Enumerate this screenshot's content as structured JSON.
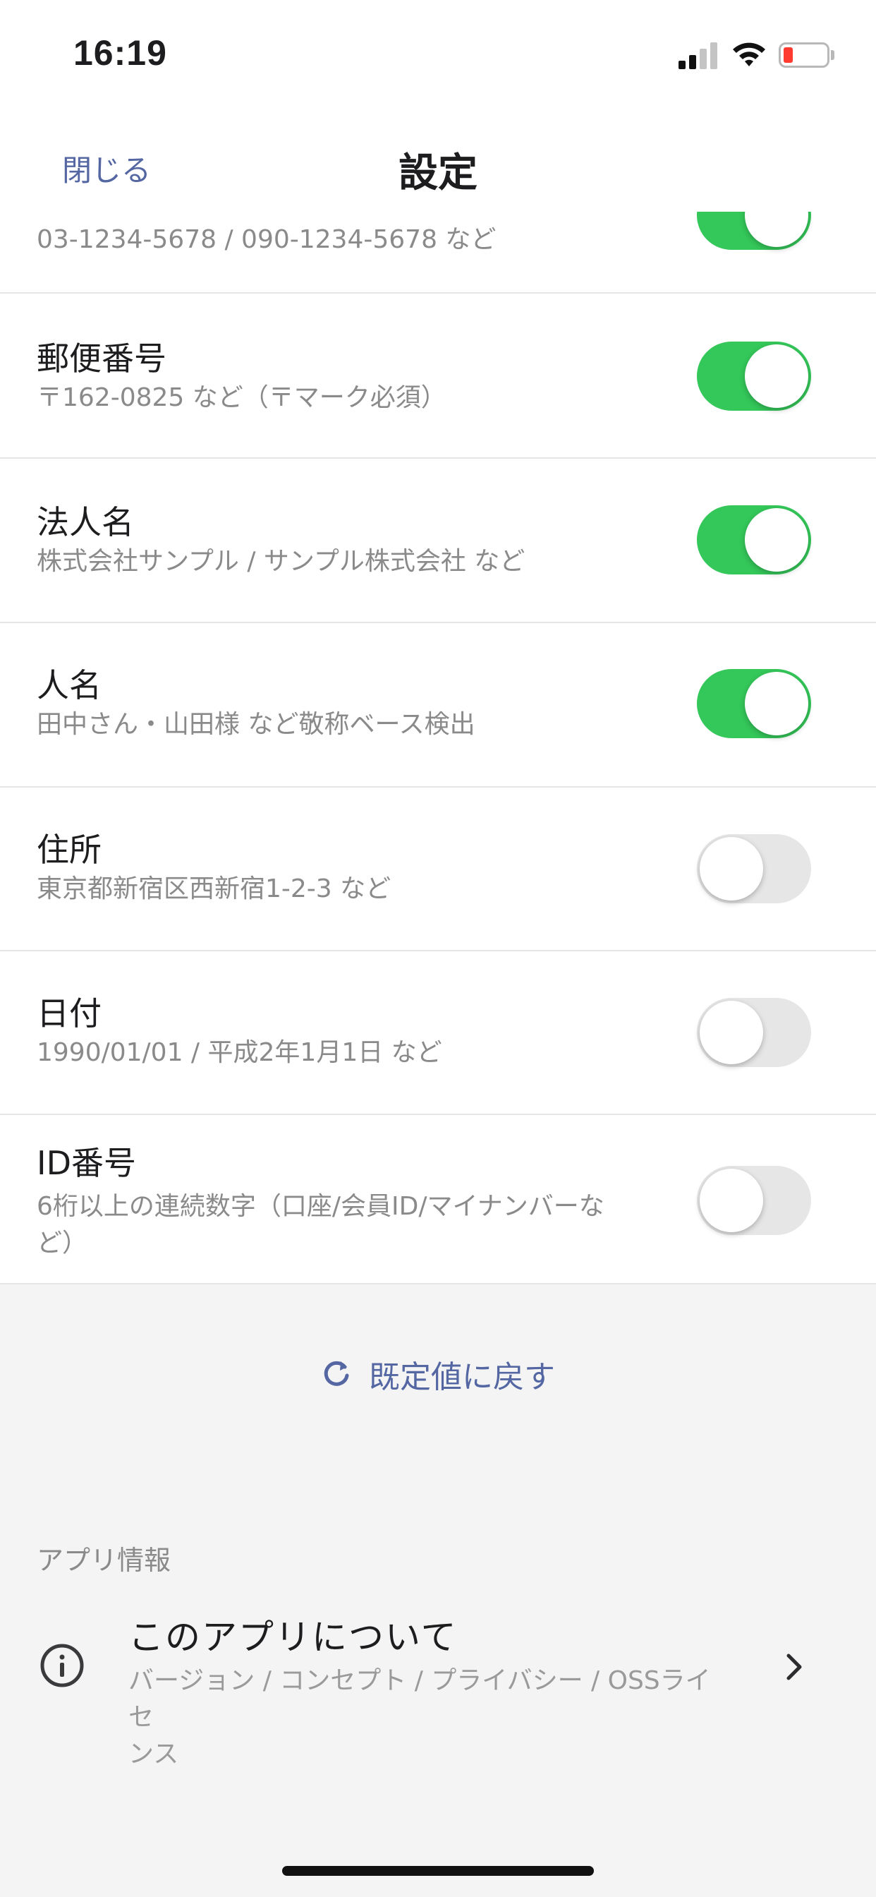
{
  "status_bar": {
    "time": "16:19",
    "battery_color": "#ff3b30"
  },
  "nav": {
    "close_label": "閉じる",
    "title": "設定"
  },
  "partial_row": {
    "desc": "03-1234-5678 / 090-1234-5678 など",
    "toggle_on": true
  },
  "rows": [
    {
      "title": "郵便番号",
      "desc": "〒162-0825 など（〒マーク必須）",
      "toggle_on": true
    },
    {
      "title": "法人名",
      "desc": "株式会社サンプル / サンプル株式会社 など",
      "toggle_on": true
    },
    {
      "title": "人名",
      "desc": "田中さん・山田様 など敬称ベース検出",
      "toggle_on": true
    },
    {
      "title": "住所",
      "desc": "東京都新宿区西新宿1-2-3 など",
      "toggle_on": false
    },
    {
      "title": "日付",
      "desc": "1990/01/01 / 平成2年1月1日 など",
      "toggle_on": false
    },
    {
      "title": "ID番号",
      "desc_line1": "6桁以上の連続数字（口座/会員ID/マイナンバーな",
      "desc_line2": "ど）",
      "toggle_on": false
    }
  ],
  "reset": {
    "label": "既定値に戻す",
    "icon": "refresh-icon"
  },
  "app_info": {
    "section_label": "アプリ情報",
    "about_title": "このアプリについて",
    "about_desc_line1": "バージョン / コンセプト / プライバシー / OSSライセ",
    "about_desc_line2": "ンス",
    "icon": "info-icon"
  },
  "colors": {
    "accent": "#5567a3",
    "toggle_on": "#34c759",
    "toggle_off": "#e6e6e6"
  }
}
